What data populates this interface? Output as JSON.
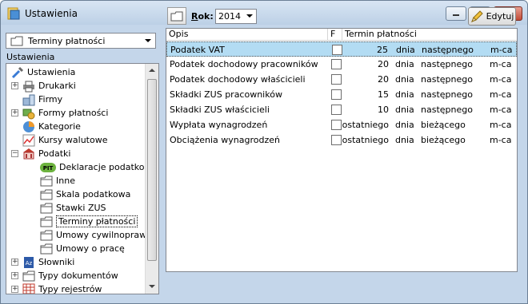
{
  "window": {
    "title": "Ustawienia"
  },
  "left": {
    "combo_value": "Terminy płatności",
    "section_label": "Ustawienia",
    "tree": [
      {
        "label": "Ustawienia",
        "level": 0,
        "icon": "tools-icon",
        "expander": ""
      },
      {
        "label": "Drukarki",
        "level": 1,
        "icon": "printer-icon",
        "expander": "+"
      },
      {
        "label": "Firmy",
        "level": 1,
        "icon": "building-icon",
        "expander": ""
      },
      {
        "label": "Formy płatności",
        "level": 1,
        "icon": "payment-forms-icon",
        "expander": "+"
      },
      {
        "label": "Kategorie",
        "level": 1,
        "icon": "pie-chart-icon",
        "expander": ""
      },
      {
        "label": "Kursy walutowe",
        "level": 1,
        "icon": "line-chart-icon",
        "expander": ""
      },
      {
        "label": "Podatki",
        "level": 1,
        "icon": "bank-icon",
        "expander": "-"
      },
      {
        "label": "Deklaracje podatkowe",
        "level": 2,
        "icon": "pit-icon",
        "expander": ""
      },
      {
        "label": "Inne",
        "level": 2,
        "icon": "folder-icon",
        "expander": ""
      },
      {
        "label": "Skala podatkowa",
        "level": 2,
        "icon": "folder-icon",
        "expander": ""
      },
      {
        "label": "Stawki ZUS",
        "level": 2,
        "icon": "folder-icon",
        "expander": ""
      },
      {
        "label": "Terminy płatności",
        "level": 2,
        "icon": "folder-icon",
        "expander": "",
        "selected": true
      },
      {
        "label": "Umowy cywilnoprawne",
        "level": 2,
        "icon": "folder-icon",
        "expander": ""
      },
      {
        "label": "Umowy o pracę",
        "level": 2,
        "icon": "folder-icon",
        "expander": ""
      },
      {
        "label": "Słowniki",
        "level": 1,
        "icon": "dictionary-icon",
        "expander": "+"
      },
      {
        "label": "Typy dokumentów",
        "level": 1,
        "icon": "folder-icon",
        "expander": "+"
      },
      {
        "label": "Typy rejestrów",
        "level": 1,
        "icon": "register-icon",
        "expander": "+"
      }
    ]
  },
  "toolbar": {
    "rok_label_u": "R",
    "rok_label_rest": "ok:",
    "rok_value": "2014",
    "edit_label": "Edytuj"
  },
  "grid": {
    "headers": [
      "Opis",
      "F",
      "Termin płatności"
    ],
    "rows": [
      {
        "opis": "Podatek VAT",
        "f": false,
        "num": "25",
        "unit": "dnia",
        "when": "następnego",
        "period": "m-ca",
        "selected": true
      },
      {
        "opis": "Podatek dochodowy pracowników",
        "f": false,
        "num": "20",
        "unit": "dnia",
        "when": "następnego",
        "period": "m-ca"
      },
      {
        "opis": "Podatek dochodowy właścicieli",
        "f": false,
        "num": "20",
        "unit": "dnia",
        "when": "następnego",
        "period": "m-ca"
      },
      {
        "opis": "Składki ZUS pracowników",
        "f": false,
        "num": "15",
        "unit": "dnia",
        "when": "następnego",
        "period": "m-ca"
      },
      {
        "opis": "Składki ZUS właścicieli",
        "f": false,
        "num": "10",
        "unit": "dnia",
        "when": "następnego",
        "period": "m-ca"
      },
      {
        "opis": "Wypłata wynagrodzeń",
        "f": false,
        "num": "ostatniego",
        "unit": "dnia",
        "when": "bieżącego",
        "period": "m-ca"
      },
      {
        "opis": "Obciążenia wynagrodzeń",
        "f": false,
        "num": "ostatniego",
        "unit": "dnia",
        "when": "bieżącego",
        "period": "m-ca"
      }
    ]
  },
  "colors": {
    "selection": "#b3dcf3",
    "frame": "#c4d6ea"
  }
}
